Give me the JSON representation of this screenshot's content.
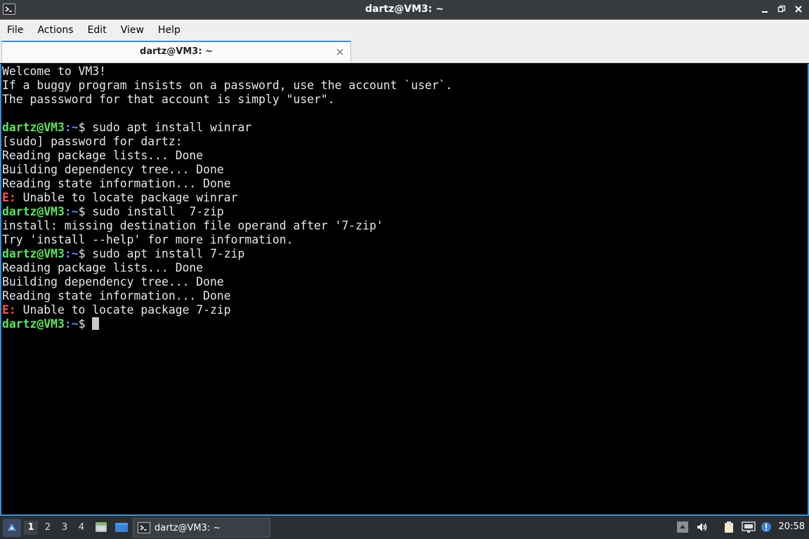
{
  "window": {
    "title": "dartz@VM3: ~",
    "icon": "terminal-icon"
  },
  "menu": {
    "items": [
      "File",
      "Actions",
      "Edit",
      "View",
      "Help"
    ]
  },
  "tab": {
    "label": "dartz@VM3: ~"
  },
  "terminal": {
    "prompt_user": "dartz@VM3",
    "prompt_path": ":~",
    "prompt_symbol": "$ ",
    "lines": [
      {
        "type": "text",
        "text": "Welcome to VM3!"
      },
      {
        "type": "text",
        "text": "If a buggy program insists on a password, use the account `user`."
      },
      {
        "type": "text",
        "text": "The passsword for that account is simply \"user\"."
      },
      {
        "type": "text",
        "text": ""
      },
      {
        "type": "prompt",
        "text": "sudo apt install winrar"
      },
      {
        "type": "text",
        "text": "[sudo] password for dartz:"
      },
      {
        "type": "text",
        "text": "Reading package lists... Done"
      },
      {
        "type": "text",
        "text": "Building dependency tree... Done"
      },
      {
        "type": "text",
        "text": "Reading state information... Done"
      },
      {
        "type": "error",
        "prefix": "E:",
        "text": " Unable to locate package winrar"
      },
      {
        "type": "prompt",
        "text": "sudo install  7-zip"
      },
      {
        "type": "text",
        "text": "install: missing destination file operand after '7-zip'"
      },
      {
        "type": "text",
        "text": "Try 'install --help' for more information."
      },
      {
        "type": "prompt",
        "text": "sudo apt install 7-zip"
      },
      {
        "type": "text",
        "text": "Reading package lists... Done"
      },
      {
        "type": "text",
        "text": "Building dependency tree... Done"
      },
      {
        "type": "text",
        "text": "Reading state information... Done"
      },
      {
        "type": "error",
        "prefix": "E:",
        "text": " Unable to locate package 7-zip"
      },
      {
        "type": "cursor",
        "text": ""
      }
    ]
  },
  "taskbar": {
    "desktops": [
      "1",
      "2",
      "3",
      "4"
    ],
    "active_desktop": "1",
    "task_label": "dartz@VM3: ~",
    "clock": "20:58",
    "tray_icons": [
      "up-arrow-icon",
      "volume-icon",
      "clipboard-icon",
      "network-icon",
      "update-notifier-icon"
    ]
  },
  "colors": {
    "accent": "#3c8fd6",
    "prompt_user": "#5fe35f",
    "prompt_path": "#5a8bff",
    "error": "#ff5555"
  }
}
